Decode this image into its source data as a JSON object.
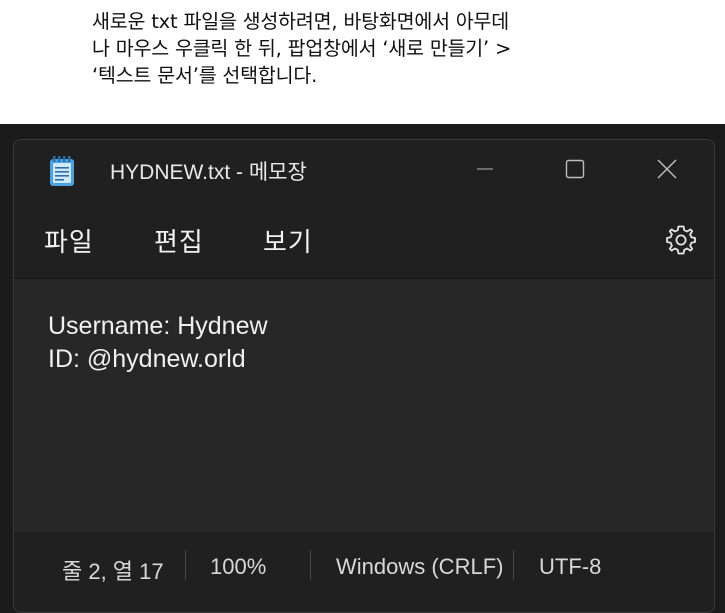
{
  "caption": {
    "lines": [
      "새로운 txt 파일을 생성하려면, 바탕화면에서 아무데",
      "나 마우스 우클릭 한 뒤, 팝업창에서 ‘새로 만들기’ >",
      "‘텍스트 문서’를 선택합니다."
    ]
  },
  "window": {
    "title": "HYDNEW.txt - 메모장",
    "controls": {
      "minimize": "—",
      "maximize": "☐",
      "close": "✕"
    }
  },
  "menu": {
    "items": [
      {
        "label": "파일"
      },
      {
        "label": "편집"
      },
      {
        "label": "보기"
      }
    ],
    "settings_icon": "gear-icon"
  },
  "editor": {
    "lines": [
      "Username: Hydnew",
      "ID: @hydnew.orld"
    ]
  },
  "status": {
    "position": "줄 2, 열 17",
    "zoom": "100%",
    "line_ending": "Windows (CRLF)",
    "encoding": "UTF-8"
  },
  "colors": {
    "background": "#202020",
    "editor": "#272727",
    "text": "#f0f0f0",
    "icon_accent": "#4aa3e0"
  }
}
